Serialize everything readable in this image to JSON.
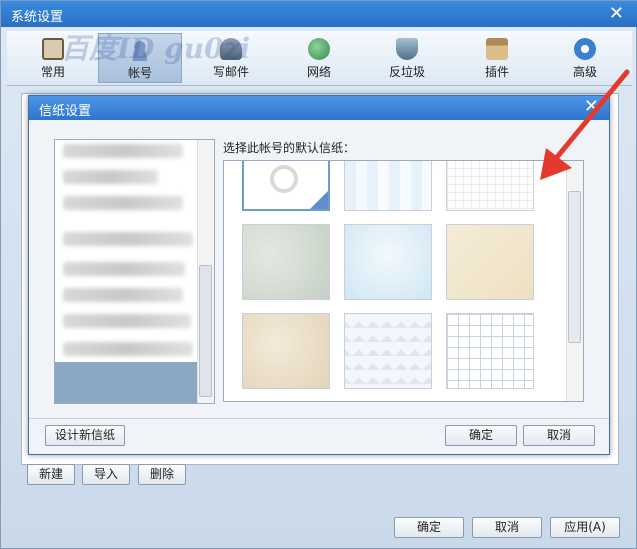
{
  "window": {
    "title": "系统设置",
    "watermark": "百度ID gu0zi",
    "close": "✕"
  },
  "toolbar": [
    {
      "label": "常用",
      "icon": "phone-icon",
      "color": "#6b5a3a"
    },
    {
      "label": "帐号",
      "icon": "person-icon",
      "color": "#6a86b0"
    },
    {
      "label": "写邮件",
      "icon": "pen-icon",
      "color": "#5a6f86"
    },
    {
      "label": "网络",
      "icon": "globe-icon",
      "color": "#2f8a4a"
    },
    {
      "label": "反垃圾",
      "icon": "shield-icon",
      "color": "#4b6f8a"
    },
    {
      "label": "插件",
      "icon": "box-icon",
      "color": "#8a6a3a"
    },
    {
      "label": "高级",
      "icon": "gear-icon",
      "color": "#3a7fd0"
    }
  ],
  "account_buttons": {
    "new": "新建",
    "import": "导入",
    "delete": "删除"
  },
  "footer": {
    "ok": "确定",
    "cancel": "取消",
    "apply": "应用(A)"
  },
  "dialog": {
    "title": "信纸设置",
    "close": "✕",
    "prompt": "选择此帐号的默认信纸：",
    "design_button": "设计新信纸",
    "ok": "确定",
    "cancel": "取消",
    "papers": [
      {
        "name": "none",
        "selected": true
      },
      {
        "name": "light-blue-check"
      },
      {
        "name": "light-grid"
      },
      {
        "name": "gray-texture"
      },
      {
        "name": "blue-texture"
      },
      {
        "name": "beige-parchment"
      },
      {
        "name": "tan-speckle"
      },
      {
        "name": "blue-weave"
      },
      {
        "name": "blue-grid"
      }
    ]
  }
}
